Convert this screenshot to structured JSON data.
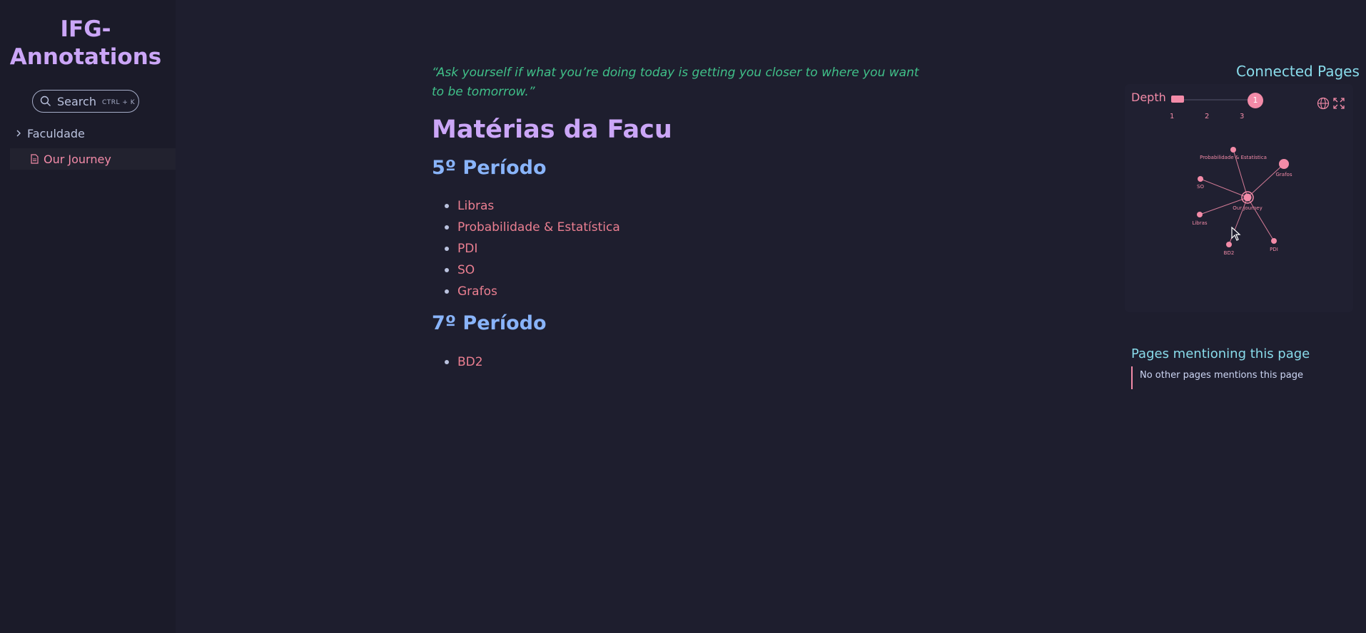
{
  "sidebar": {
    "title": "IFG-Annotations",
    "search": {
      "label": "Search",
      "shortcut": "CTRL + K"
    },
    "folder": "Faculdade",
    "current_page": "Our Journey"
  },
  "article": {
    "quote": "“Ask yourself if what you’re doing today is getting you closer to where you want to be tomorrow.”",
    "title": "Matérias da Facu",
    "sections": [
      {
        "heading": "5º Período",
        "items": [
          "Libras",
          "Probabilidade & Estatística",
          "PDI",
          "SO",
          "Grafos"
        ]
      },
      {
        "heading": "7º Período",
        "items": [
          "BD2"
        ]
      }
    ]
  },
  "graph": {
    "title": "Connected Pages",
    "depth_label": "Depth",
    "depth_value": "1",
    "depth_ticks": [
      "1",
      "2",
      "3"
    ],
    "nodes": [
      "Probabilidade & Estatística",
      "Grafos",
      "SO",
      "Our Journey",
      "Libras",
      "BD2",
      "PDI"
    ]
  },
  "mentions": {
    "title": "Pages mentioning this page",
    "empty_text": "No other pages mentions this page"
  },
  "colors": {
    "background": "#1e1e2e",
    "accent_pink": "#f38ba8",
    "title_purple": "#cba6f7",
    "heading_blue": "#89b4fa",
    "quote_green": "#40c089",
    "teal": "#89dceb"
  }
}
